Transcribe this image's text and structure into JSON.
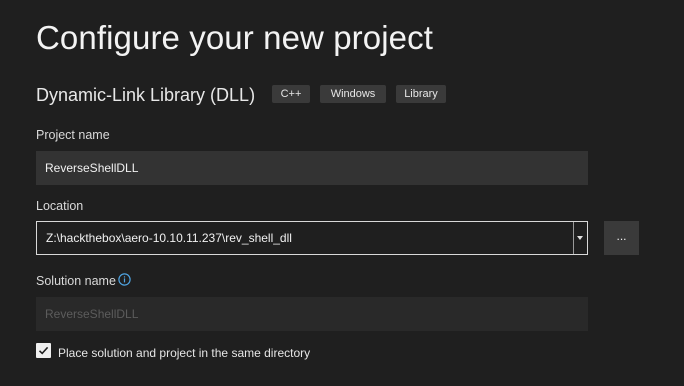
{
  "title": "Configure your new project",
  "template": {
    "name": "Dynamic-Link Library (DLL)",
    "tags": [
      "C++",
      "Windows",
      "Library"
    ]
  },
  "project_name": {
    "label": "Project name",
    "value": "ReverseShellDLL"
  },
  "location": {
    "label": "Location",
    "value": "Z:\\hackthebox\\aero-10.10.11.237\\rev_shell_dll",
    "browse_label": "..."
  },
  "solution_name": {
    "label": "Solution name",
    "placeholder": "ReverseShellDLL",
    "info_icon": "info-circle-icon"
  },
  "same_directory": {
    "label": "Place solution and project in the same directory",
    "checked": true
  },
  "colors": {
    "background": "#1f1f1f",
    "field": "#333333",
    "tag": "#3a3a3a",
    "info_accent": "#4fa3e0"
  }
}
